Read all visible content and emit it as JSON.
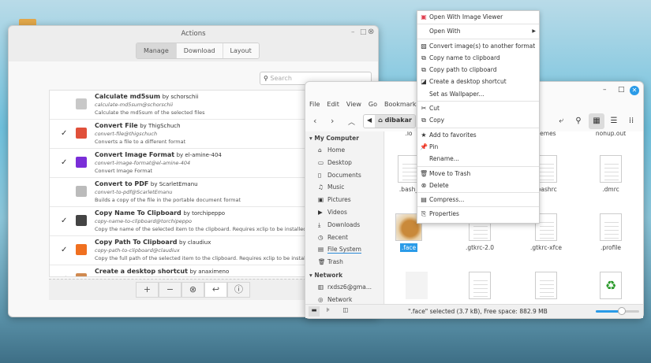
{
  "actions_window": {
    "title": "Actions",
    "tabs": [
      {
        "label": "Manage",
        "selected": true
      },
      {
        "label": "Download"
      },
      {
        "label": "Layout"
      }
    ],
    "search_placeholder": "Search",
    "items": [
      {
        "name": "Calculate md5sum",
        "by": "by schorschii",
        "id": "calculate-md5sum@schorschii",
        "desc": "Calculate the md5sum of the selected files",
        "enabled": false,
        "icon": "md5-file-icon",
        "color": "#c8c8c8"
      },
      {
        "name": "Convert File",
        "by": "by ThigSchuch",
        "id": "convert-file@thigschuch",
        "desc": "Converts a file to a different format",
        "enabled": true,
        "icon": "convert-file-icon",
        "color": "#e0503a"
      },
      {
        "name": "Convert Image Format",
        "by": "by el-amine-404",
        "id": "convert-image-format@el-amine-404",
        "desc": "Convert Image Format",
        "enabled": true,
        "icon": "convert-image-icon",
        "color": "#7a2ed8"
      },
      {
        "name": "Convert to PDF",
        "by": "by ScarletEmanu",
        "id": "convert-to-pdf@ScarletEmanu",
        "desc": "Builds a copy of the file in the portable document format",
        "enabled": false,
        "icon": "pdf-icon",
        "color": "#bbbbbb"
      },
      {
        "name": "Copy Name To Clipboard",
        "by": "by torchipeppo",
        "id": "copy-name-to-clipboard@torchipeppo",
        "desc": "Copy the name of the selected item to the clipboard. Requires xclip to be installed.",
        "enabled": true,
        "icon": "copy-name-icon",
        "color": "#444444"
      },
      {
        "name": "Copy Path To Clipboard",
        "by": "by claudiux",
        "id": "copy-path-to-clipboard@claudiux",
        "desc": "Copy the full path of the selected item to the clipboard. Requires xclip to be installed.",
        "enabled": true,
        "icon": "copy-path-icon",
        "color": "#f07020"
      },
      {
        "name": "Create a desktop shortcut",
        "by": "by anaximeno",
        "id": "",
        "desc": "",
        "enabled": true,
        "icon": "desktop-shortcut-icon",
        "color": "#d08a50"
      }
    ],
    "toolbar": [
      "+",
      "−",
      "⊗",
      "↩",
      "ⓘ"
    ]
  },
  "file_manager": {
    "menu": [
      "File",
      "Edit",
      "View",
      "Go",
      "Bookmarks"
    ],
    "breadcrumb": "dibakar",
    "sidebar": {
      "my_computer": "My Computer",
      "items": [
        {
          "label": "Home",
          "icon": "⌂"
        },
        {
          "label": "Desktop",
          "icon": "▭"
        },
        {
          "label": "Documents",
          "icon": "▯"
        },
        {
          "label": "Music",
          "icon": "♫"
        },
        {
          "label": "Pictures",
          "icon": "▣"
        },
        {
          "label": "Videos",
          "icon": "▶"
        },
        {
          "label": "Downloads",
          "icon": "⤓"
        },
        {
          "label": "Recent",
          "icon": "◷"
        },
        {
          "label": "File System",
          "icon": "▤"
        },
        {
          "label": "Trash",
          "icon": "🗑"
        }
      ],
      "network": "Network",
      "network_items": [
        {
          "label": "rxdsz6@gma...",
          "icon": "▥"
        },
        {
          "label": "Network",
          "icon": "◎"
        }
      ]
    },
    "files_top": [
      ".lo",
      "hemes",
      "nohup.out"
    ],
    "files": [
      ".bash_",
      ".bashrc",
      ".dmrc",
      ".face",
      ".gtkrc-2.0",
      ".gtkrc-xfce",
      ".profile"
    ],
    "status": "\".face\" selected (3.7 kB), Free space: 882.9 MB",
    "zoom_level": 0.6
  },
  "context_menu": {
    "items": [
      {
        "label": "Open With Image Viewer",
        "icon": "image-viewer-icon"
      },
      {
        "sep": true
      },
      {
        "label": "Open With",
        "icon": "",
        "submenu": true
      },
      {
        "sep": true
      },
      {
        "label": "Convert image(s) to another format",
        "icon": "image-icon"
      },
      {
        "label": "Copy name to clipboard",
        "icon": "copy-icon"
      },
      {
        "label": "Copy path to clipboard",
        "icon": "copy-icon"
      },
      {
        "label": "Create a desktop shortcut",
        "icon": "shortcut-icon"
      },
      {
        "label": "Set as Wallpaper...",
        "icon": ""
      },
      {
        "sep": true
      },
      {
        "label": "Cut",
        "icon": "cut-icon"
      },
      {
        "label": "Copy",
        "icon": "copy-icon"
      },
      {
        "sep": true
      },
      {
        "label": "Add to favorites",
        "icon": "star-icon"
      },
      {
        "label": "Pin",
        "icon": "pin-icon"
      },
      {
        "label": "Rename...",
        "icon": ""
      },
      {
        "sep": true
      },
      {
        "label": "Move to Trash",
        "icon": "trash-icon"
      },
      {
        "label": "Delete",
        "icon": "delete-icon"
      },
      {
        "sep": true
      },
      {
        "label": "Compress...",
        "icon": "compress-icon"
      },
      {
        "sep": true
      },
      {
        "label": "Properties",
        "icon": "properties-icon"
      }
    ]
  }
}
